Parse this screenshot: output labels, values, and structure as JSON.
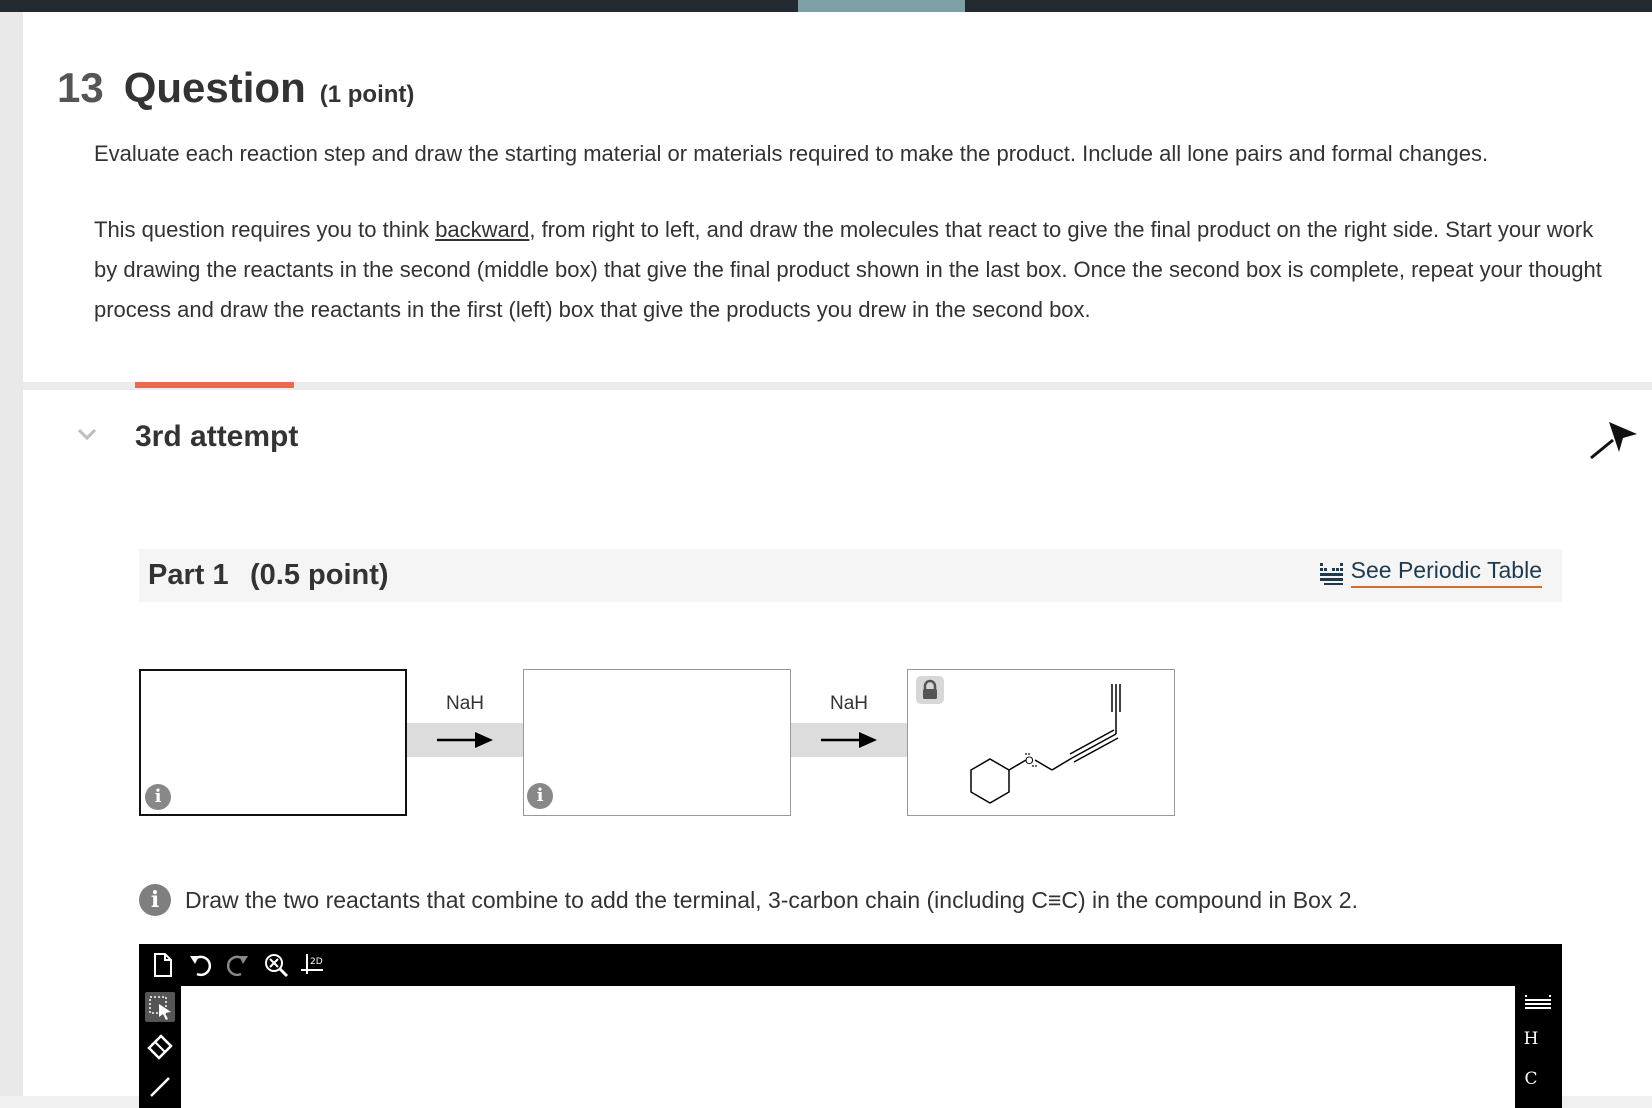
{
  "question": {
    "number": "13",
    "title": "Question",
    "points": "(1 point)",
    "instruction": "Evaluate each reaction step and draw the starting material or materials required to make the product. Include all lone pairs and formal changes.",
    "para2": {
      "part_a": "This question requires you to think ",
      "part_b": "backward",
      "part_c": ", from right to left, and draw the molecules that react to give the final product on the right side. Start your work by drawing the reactants in the second (middle box) that give the final product shown in the last box. Once the second box is complete, repeat your thought process and draw the reactants in the first (left) box that give the products you drew in the second box."
    }
  },
  "attempt": {
    "label": "3rd attempt"
  },
  "part": {
    "label": "Part 1",
    "points": "(0.5 point)",
    "periodic_table_link": "See Periodic Table"
  },
  "reaction": {
    "reagent1": "NaH",
    "reagent2": "NaH",
    "product_atom": "O"
  },
  "hint": {
    "text": "Draw the two reactants that combine to add the terminal, 3-carbon chain (including C≡C) in the compound in Box 2."
  },
  "editor": {
    "elements": [
      "H",
      "C"
    ],
    "template_label": "2D"
  },
  "colors": {
    "topbar": "#222a30",
    "accent": "#e86a4a",
    "link_underline": "#c7702f"
  }
}
